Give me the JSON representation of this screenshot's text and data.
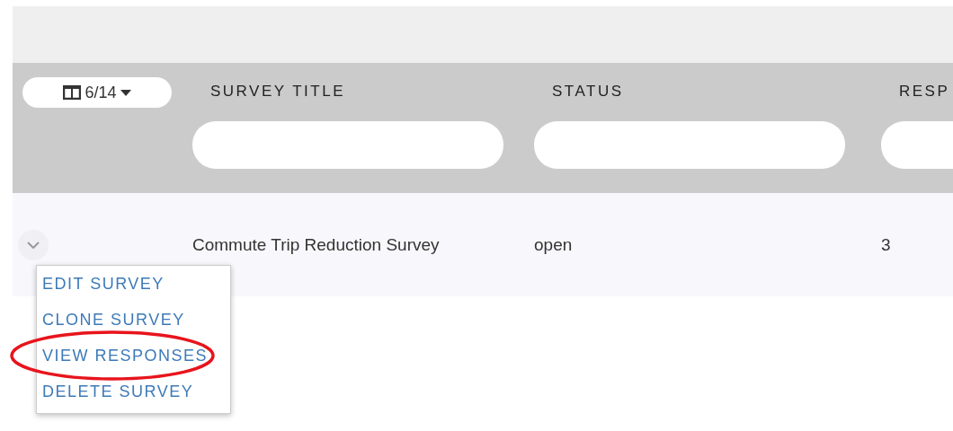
{
  "column_toggle": {
    "label": "6/14"
  },
  "columns": [
    {
      "label": "SURVEY TITLE"
    },
    {
      "label": "STATUS"
    },
    {
      "label": "RESP"
    }
  ],
  "rows": [
    {
      "expanded": true,
      "cells": [
        "Commute Trip Reduction Survey",
        "open",
        "3"
      ]
    }
  ],
  "row_menu": {
    "items": [
      {
        "label": "EDIT SURVEY"
      },
      {
        "label": "CLONE SURVEY"
      },
      {
        "label": "VIEW RESPONSES"
      },
      {
        "label": "DELETE SURVEY"
      }
    ]
  },
  "annotation": {
    "kind": "ellipse",
    "color": "#e8141c"
  }
}
